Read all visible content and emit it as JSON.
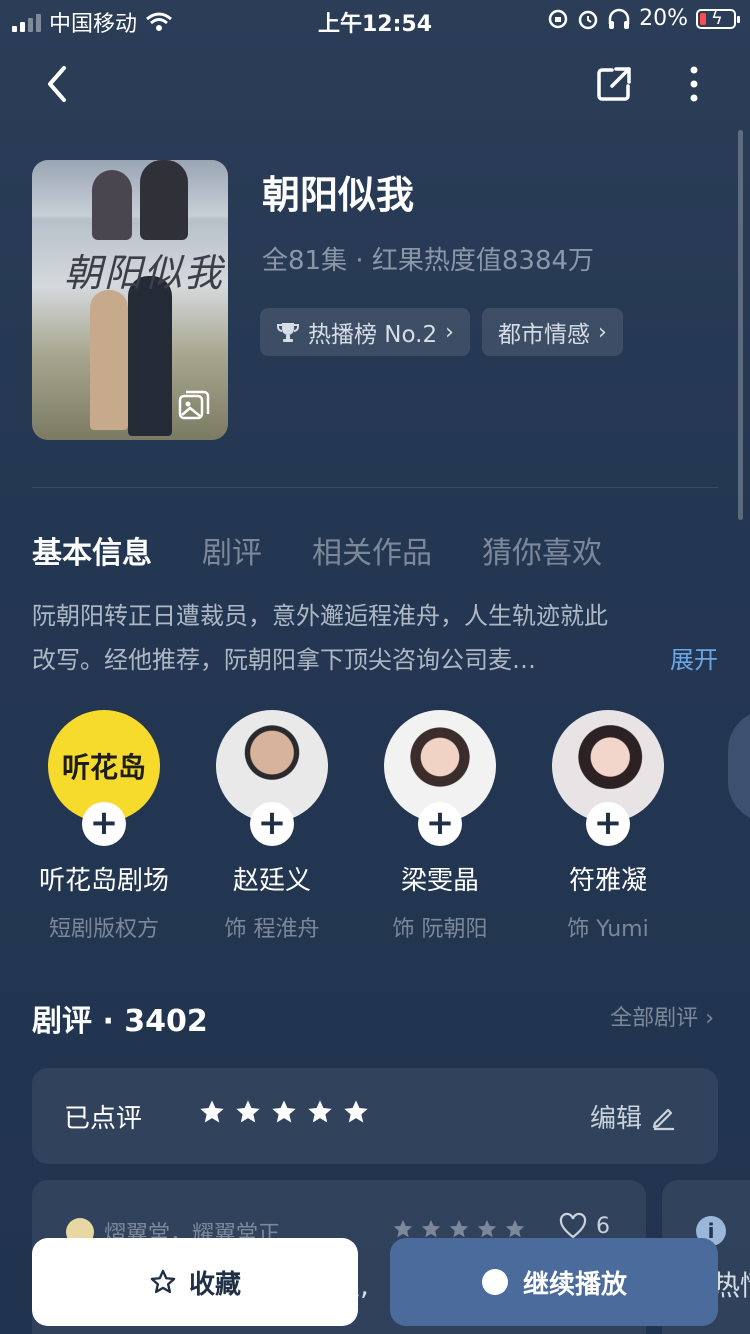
{
  "status": {
    "carrier": "中国移动",
    "time": "上午12:54",
    "battery": "20%"
  },
  "poster": {
    "title_art": "朝阳似我"
  },
  "header": {
    "title": "朝阳似我",
    "meta": "全81集 · 红果热度值8384万",
    "chips": [
      {
        "label": "热播榜 No.2",
        "icon": "trophy-icon"
      },
      {
        "label": "都市情感"
      }
    ]
  },
  "tabs": [
    "基本信息",
    "剧评",
    "相关作品",
    "猜你喜欢"
  ],
  "synopsis": {
    "line1": "阮朝阳转正日遭裁员，意外邂逅程淮舟，人生轨迹就此",
    "line2": "改写。经他推荐，阮朝阳拿下顶尖咨询公司麦…",
    "expand": "展开"
  },
  "cast": [
    {
      "name": "听花岛剧场",
      "role": "短剧版权方",
      "logo": "听花岛"
    },
    {
      "name": "赵廷义",
      "role": "饰 程淮舟"
    },
    {
      "name": "梁雯晶",
      "role": "饰 阮朝阳"
    },
    {
      "name": "符雅凝",
      "role": "饰 Yumi"
    }
  ],
  "reviews": {
    "heading": "剧评 · 3402",
    "all_label": "全部剧评",
    "rated_label": "已点评",
    "rating": 5,
    "edit_label": "编辑",
    "card": {
      "user": "熠翼堂，耀翼堂正...",
      "likes": "6",
      "snippet": "主,"
    },
    "card2_snippet": "热情"
  },
  "actions": {
    "collect_label": "收藏",
    "play_label": "继续播放"
  },
  "colors": {
    "background": "#243752",
    "accent": "#6aa7e4",
    "play_button": "#4a6b9b"
  }
}
